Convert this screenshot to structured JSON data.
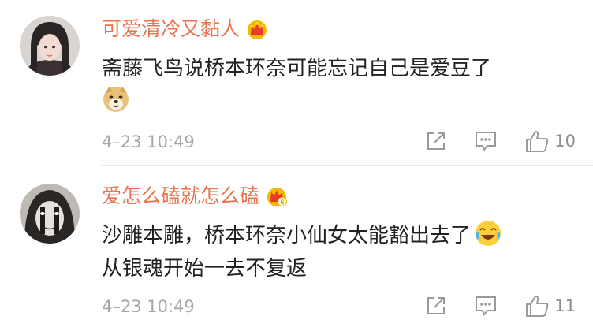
{
  "comments": [
    {
      "username": "可爱清冷又黏人",
      "badge_icon": "crown-badge-icon",
      "lines": [
        "斋藤飞鸟说桥本环奈可能忘记自己是爱豆了"
      ],
      "emoji_icon": "doge-emoji-icon",
      "timestamp": "4–23 10:49",
      "like_count": "10"
    },
    {
      "username": "爱怎么磕就怎么磕",
      "badge_icon": "crown-badge-level-6-icon",
      "badge_text": "6",
      "lines": [
        "沙雕本雕，桥本环奈小仙女太能豁出去了",
        "从银魂开始一去不复返"
      ],
      "emoji_icon": "laughing-crying-emoji-icon",
      "timestamp": "4–23 10:49",
      "like_count": "11"
    }
  ],
  "colors": {
    "username": "#eb7350",
    "timestamp": "#a8a8a8",
    "icon": "#9a9a9a",
    "badge_gold": "#f5b800"
  }
}
